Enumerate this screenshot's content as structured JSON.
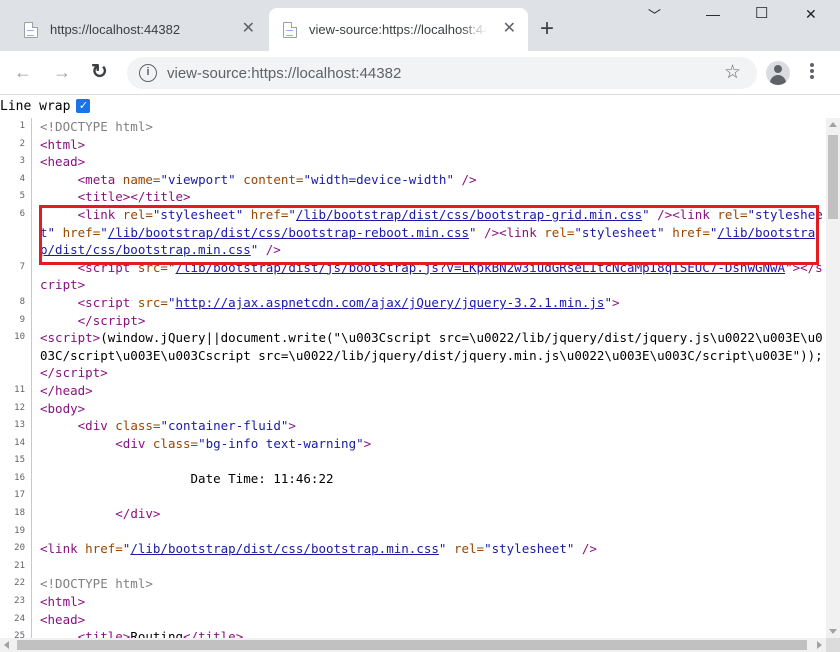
{
  "tabs": [
    {
      "title": "https://localhost:44382",
      "close": "✕"
    },
    {
      "title": "view-source:https://localhost:44382",
      "close": "✕"
    }
  ],
  "new_tab_symbol": "+",
  "window_controls": {
    "minimize": "﹀",
    "restore": "—",
    "maximize": "☐",
    "close": "✕"
  },
  "toolbar": {
    "back_icon": "←",
    "forward_icon": "→",
    "reload_icon": "↻",
    "url": "view-source:https://localhost:44382",
    "info_icon": "i",
    "star_icon": "☆"
  },
  "line_wrap": {
    "label": "Line wrap",
    "checked": true,
    "check": "✓"
  },
  "source_lines": [
    {
      "n": "1",
      "html": "<span class=\"c\">&lt;!DOCTYPE html&gt;</span>"
    },
    {
      "n": "2",
      "html": "<span class=\"t\">&lt;html&gt;</span>"
    },
    {
      "n": "3",
      "html": "<span class=\"t\">&lt;head&gt;</span>"
    },
    {
      "n": "4",
      "html": "     <span class=\"t\">&lt;meta </span><span class=\"a\">name=</span><span class=\"v\">\"viewport\"</span><span class=\"t\"> </span><span class=\"a\">content=</span><span class=\"v\">\"width=device-width\"</span><span class=\"t\"> /&gt;</span>"
    },
    {
      "n": "5",
      "html": "     <span class=\"t\">&lt;title&gt;&lt;/title&gt;</span>"
    },
    {
      "n": "6",
      "html": "     <span class=\"t\">&lt;link </span><span class=\"a\">rel=</span><span class=\"v\">\"stylesheet\"</span><span class=\"t\"> </span><span class=\"a\">href=</span><span class=\"v\">\"</span><span class=\"l\">/lib/bootstrap/dist/css/bootstrap-grid.min.css</span><span class=\"v\">\"</span><span class=\"t\"> /&gt;&lt;link </span><span class=\"a\">rel=</span><span class=\"v\">\"stylesheet\"</span><span class=\"t\"> </span><span class=\"a\">href=</span><span class=\"v\">\"</span><span class=\"l\">/lib/bootstrap/dist/css/bootstrap-reboot.min.css</span><span class=\"v\">\"</span><span class=\"t\"> /&gt;&lt;link </span><span class=\"a\">rel=</span><span class=\"v\">\"stylesheet\"</span><span class=\"t\"> </span><span class=\"a\">href=</span><span class=\"v\">\"</span><span class=\"l\">/lib/bootstrap/dist/css/bootstrap.min.css</span><span class=\"v\">\"</span><span class=\"t\"> /&gt;</span>"
    },
    {
      "n": "7",
      "html": "     <span class=\"t\">&lt;script </span><span class=\"a\">src=</span><span class=\"v\">\"</span><span class=\"l\">/lib/bootstrap/dist/js/bootstrap.js?v=LKpkBN2w3iudGRseLItcNcaMpI8qISEUC7-DsnwGNwA</span><span class=\"v\">\"</span><span class=\"t\">&gt;&lt;/script&gt;</span>"
    },
    {
      "n": "8",
      "html": "     <span class=\"t\">&lt;script </span><span class=\"a\">src=</span><span class=\"v\">\"</span><span class=\"l\">http://ajax.aspnetcdn.com/ajax/jQuery/jquery-3.2.1.min.js</span><span class=\"v\">\"</span><span class=\"t\">&gt;</span>"
    },
    {
      "n": "9",
      "html": "     <span class=\"t\">&lt;/script&gt;</span>"
    },
    {
      "n": "10",
      "html": "<span class=\"t\">&lt;script&gt;</span>(window.jQuery||document.write(\"\\u003Cscript src=\\u0022/lib/jquery/dist/jquery.js\\u0022\\u003E\\u003C/script\\u003E\\u003Cscript src=\\u0022/lib/jquery/dist/jquery.min.js\\u0022\\u003E\\u003C/script\\u003E\"));<span class=\"t\">&lt;/script&gt;</span>"
    },
    {
      "n": "11",
      "html": "<span class=\"t\">&lt;/head&gt;</span>"
    },
    {
      "n": "12",
      "html": "<span class=\"t\">&lt;body&gt;</span>"
    },
    {
      "n": "13",
      "html": "     <span class=\"t\">&lt;div </span><span class=\"a\">class=</span><span class=\"v\">\"container-fluid\"</span><span class=\"t\">&gt;</span>"
    },
    {
      "n": "14",
      "html": "          <span class=\"t\">&lt;div </span><span class=\"a\">class=</span><span class=\"v\">\"bg-info text-warning\"</span><span class=\"t\">&gt;</span>"
    },
    {
      "n": "15",
      "html": ""
    },
    {
      "n": "16",
      "html": "                    Date Time: 11:46:22"
    },
    {
      "n": "17",
      "html": ""
    },
    {
      "n": "18",
      "html": "          <span class=\"t\">&lt;/div&gt;</span>"
    },
    {
      "n": "19",
      "html": ""
    },
    {
      "n": "20",
      "html": "<span class=\"t\">&lt;link </span><span class=\"a\">href=</span><span class=\"v\">\"</span><span class=\"l\">/lib/bootstrap/dist/css/bootstrap.min.css</span><span class=\"v\">\"</span><span class=\"t\"> </span><span class=\"a\">rel=</span><span class=\"v\">\"stylesheet\"</span><span class=\"t\"> /&gt;</span>"
    },
    {
      "n": "21",
      "html": ""
    },
    {
      "n": "22",
      "html": "<span class=\"c\">&lt;!DOCTYPE html&gt;</span>"
    },
    {
      "n": "23",
      "html": "<span class=\"t\">&lt;html&gt;</span>"
    },
    {
      "n": "24",
      "html": "<span class=\"t\">&lt;head&gt;</span>"
    },
    {
      "n": "25",
      "html": "     <span class=\"t\">&lt;title&gt;</span>Routing<span class=\"t\">&lt;/title&gt;</span>"
    }
  ],
  "colors": {
    "tag": "#881280",
    "attr": "#994500",
    "value": "#1a1aa6",
    "comment": "#808080",
    "highlight_border": "#e41b23"
  }
}
